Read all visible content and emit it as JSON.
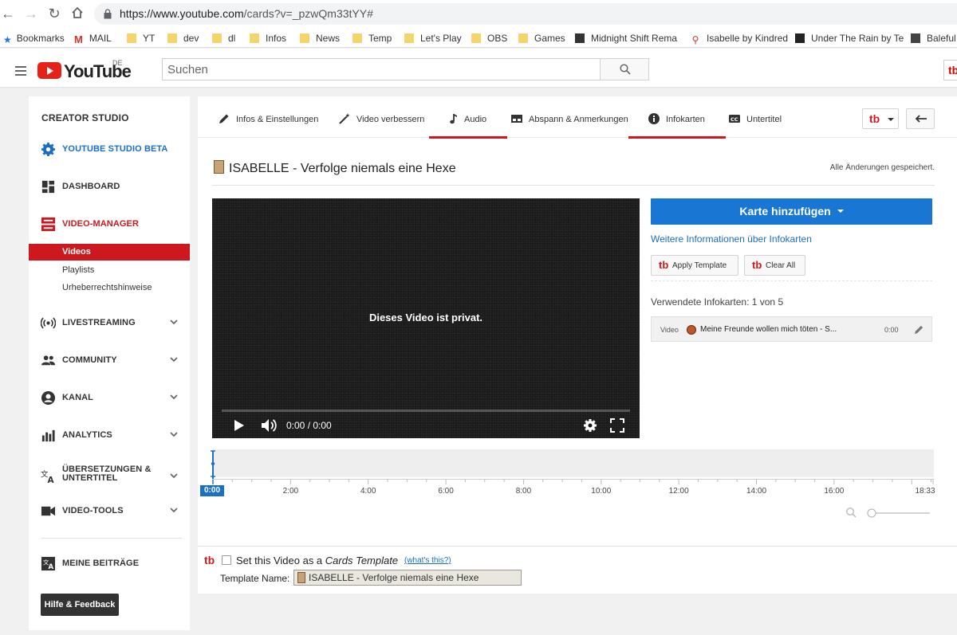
{
  "browser": {
    "url_host": "https://www.youtube.com",
    "url_path": "/cards?v=_pzwQm33tYY#",
    "bookmarks": [
      {
        "label": "Bookmarks",
        "icon": "star-icon"
      },
      {
        "label": "MAIL",
        "icon": "gmail-icon"
      },
      {
        "label": "YT",
        "icon": "folder-icon"
      },
      {
        "label": "dev",
        "icon": "folder-icon"
      },
      {
        "label": "dl",
        "icon": "folder-icon"
      },
      {
        "label": "Infos",
        "icon": "folder-icon"
      },
      {
        "label": "News",
        "icon": "folder-icon"
      },
      {
        "label": "Temp",
        "icon": "folder-icon"
      },
      {
        "label": "Let's Play",
        "icon": "folder-icon"
      },
      {
        "label": "OBS",
        "icon": "folder-icon"
      },
      {
        "label": "Games",
        "icon": "folder-icon"
      },
      {
        "label": "Midnight Shift Rema",
        "icon": "page-icon"
      },
      {
        "label": "Isabelle by Kindred",
        "icon": "page-icon"
      },
      {
        "label": "Under The Rain by Te",
        "icon": "page-icon"
      },
      {
        "label": "Baleful",
        "icon": "page-icon"
      }
    ]
  },
  "header": {
    "logo_text": "YouTube",
    "region": "DE",
    "search_placeholder": "Suchen",
    "tb_label": "tb"
  },
  "leftnav": {
    "title": "CREATOR STUDIO",
    "studio_beta": "YOUTUBE STUDIO BETA",
    "dashboard": "DASHBOARD",
    "video_manager": "VIDEO-MANAGER",
    "sub_videos": "Videos",
    "sub_playlists": "Playlists",
    "sub_copyright": "Urheberrechtshinweise",
    "livestreaming": "LIVESTREAMING",
    "community": "COMMUNITY",
    "kanal": "KANAL",
    "analytics": "ANALYTICS",
    "translations_1": "ÜBERSETZUNGEN &",
    "translations_2": "UNTERTITEL",
    "video_tools": "VIDEO-TOOLS",
    "contributions": "MEINE BEITRÄGE",
    "help": "Hilfe & Feedback"
  },
  "tabs": {
    "info": "Infos & Einstellungen",
    "enhance": "Video verbessern",
    "audio": "Audio",
    "endscreen": "Abspann & Anmerkungen",
    "cards": "Infokarten",
    "subtitles": "Untertitel"
  },
  "video": {
    "title": "ISABELLE - Verfolge niemals eine Hexe",
    "saved_status": "Alle Änderungen gespeichert.",
    "private_msg": "Dieses Video ist privat.",
    "time": "0:00 / 0:00"
  },
  "cards_panel": {
    "add_card": "Karte hinzufügen",
    "more_info": "Weitere Informationen über Infokarten",
    "apply_template": "Apply Template",
    "clear_all": "Clear All",
    "used_cards": "Verwendete Infokarten: 1 von 5",
    "card": {
      "type": "Video",
      "title": "Meine Freunde wollen mich töten - S...",
      "time": "0:00"
    }
  },
  "timeline": {
    "current": "0:00",
    "ticks": [
      "2:00",
      "4:00",
      "6:00",
      "8:00",
      "10:00",
      "12:00",
      "14:00",
      "16:00",
      "18:33"
    ]
  },
  "template": {
    "set_label_1": "Set this Video as a ",
    "set_label_em": "Cards Template",
    "whats_this": "(what's this?)",
    "name_label": "Template Name:",
    "name_value": "ISABELLE - Verfolge niemals eine Hexe",
    "checked": false
  },
  "colors": {
    "brand_red": "#cc181e",
    "accent_blue": "#1976d2"
  }
}
